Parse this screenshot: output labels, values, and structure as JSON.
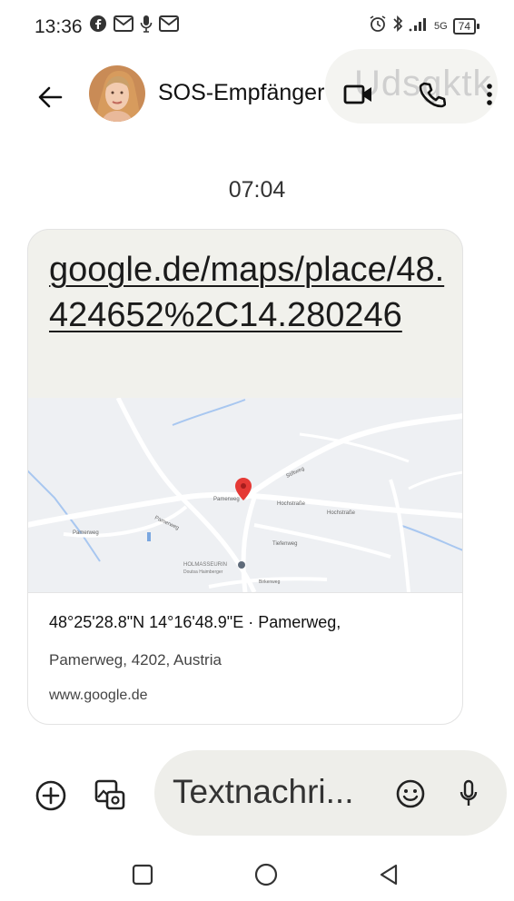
{
  "status_bar": {
    "time": "13:36",
    "left_icons": [
      "facebook-icon",
      "gmail-icon",
      "microphone-icon",
      "gmail-icon"
    ],
    "right_icons": [
      "alarm-icon",
      "bluetooth-icon",
      "signal-icon",
      "5g-icon"
    ],
    "network_label": "5G",
    "battery": "74"
  },
  "header": {
    "contact_name": "SOS-Empfänger",
    "ghost_text": "Udsgktk",
    "icons": [
      "back-arrow-icon",
      "avatar",
      "video-call-icon",
      "phone-icon",
      "more-vert-icon"
    ]
  },
  "conversation": {
    "timestamp": "07:04",
    "message": {
      "link": "google.de/maps/place/48.424652%2C14.280246",
      "preview": {
        "title": "48°25'28.8\"N 14°16'48.9\"E · Pamerweg,",
        "address": "Pamerweg, 4202, Austria",
        "domain": "www.google.de",
        "map_labels": {
          "street_1": "Pamerweg",
          "street_2": "Hochstraße",
          "street_3": "Hochstraße",
          "street_4": "Stiftweg",
          "street_5": "Pamerweg",
          "street_6": "Pamerweg",
          "street_7": "Tiefenweg",
          "street_8": "Birkenweg",
          "poi_name": "HOLMASSEURIN",
          "poi_sub": "Doutsa Haimberger"
        },
        "colors": {
          "pin": "#e53935",
          "water": "#a8c7f0",
          "road": "#ffffff",
          "land": "#eef0f3"
        }
      }
    }
  },
  "compose": {
    "placeholder": "Textnachri...",
    "icons": [
      "add-circle-icon",
      "gallery-icon",
      "emoji-icon",
      "mic-icon"
    ]
  },
  "nav_bar": {
    "icons": [
      "recents-icon",
      "home-icon",
      "back-icon"
    ]
  }
}
